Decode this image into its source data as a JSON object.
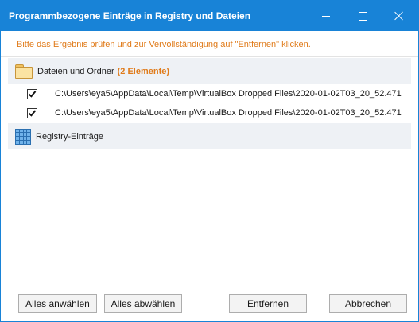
{
  "window": {
    "title": "Programmbezogene Einträge in Registry und Dateien"
  },
  "hint": "Bitte das Ergebnis prüfen und zur Vervollständigung auf \"Entfernen\" klicken.",
  "groups": {
    "files": {
      "label": "Dateien und Ordner",
      "count": "(2 Elemente)",
      "icon": "folder-icon",
      "items": [
        {
          "checked": true,
          "path": "C:\\Users\\eya5\\AppData\\Local\\Temp\\VirtualBox Dropped Files\\2020-01-02T03_20_52.471..."
        },
        {
          "checked": true,
          "path": "C:\\Users\\eya5\\AppData\\Local\\Temp\\VirtualBox Dropped Files\\2020-01-02T03_20_52.471..."
        }
      ]
    },
    "registry": {
      "label": "Registry-Einträge",
      "icon": "registry-grid-icon"
    }
  },
  "buttons": {
    "select_all": "Alles anwählen",
    "deselect_all": "Alles abwählen",
    "remove": "Entfernen",
    "cancel": "Abbrechen"
  },
  "colors": {
    "titlebar": "#1883d7",
    "accent": "#e07b1a",
    "group_header_bg": "#eef1f5"
  }
}
